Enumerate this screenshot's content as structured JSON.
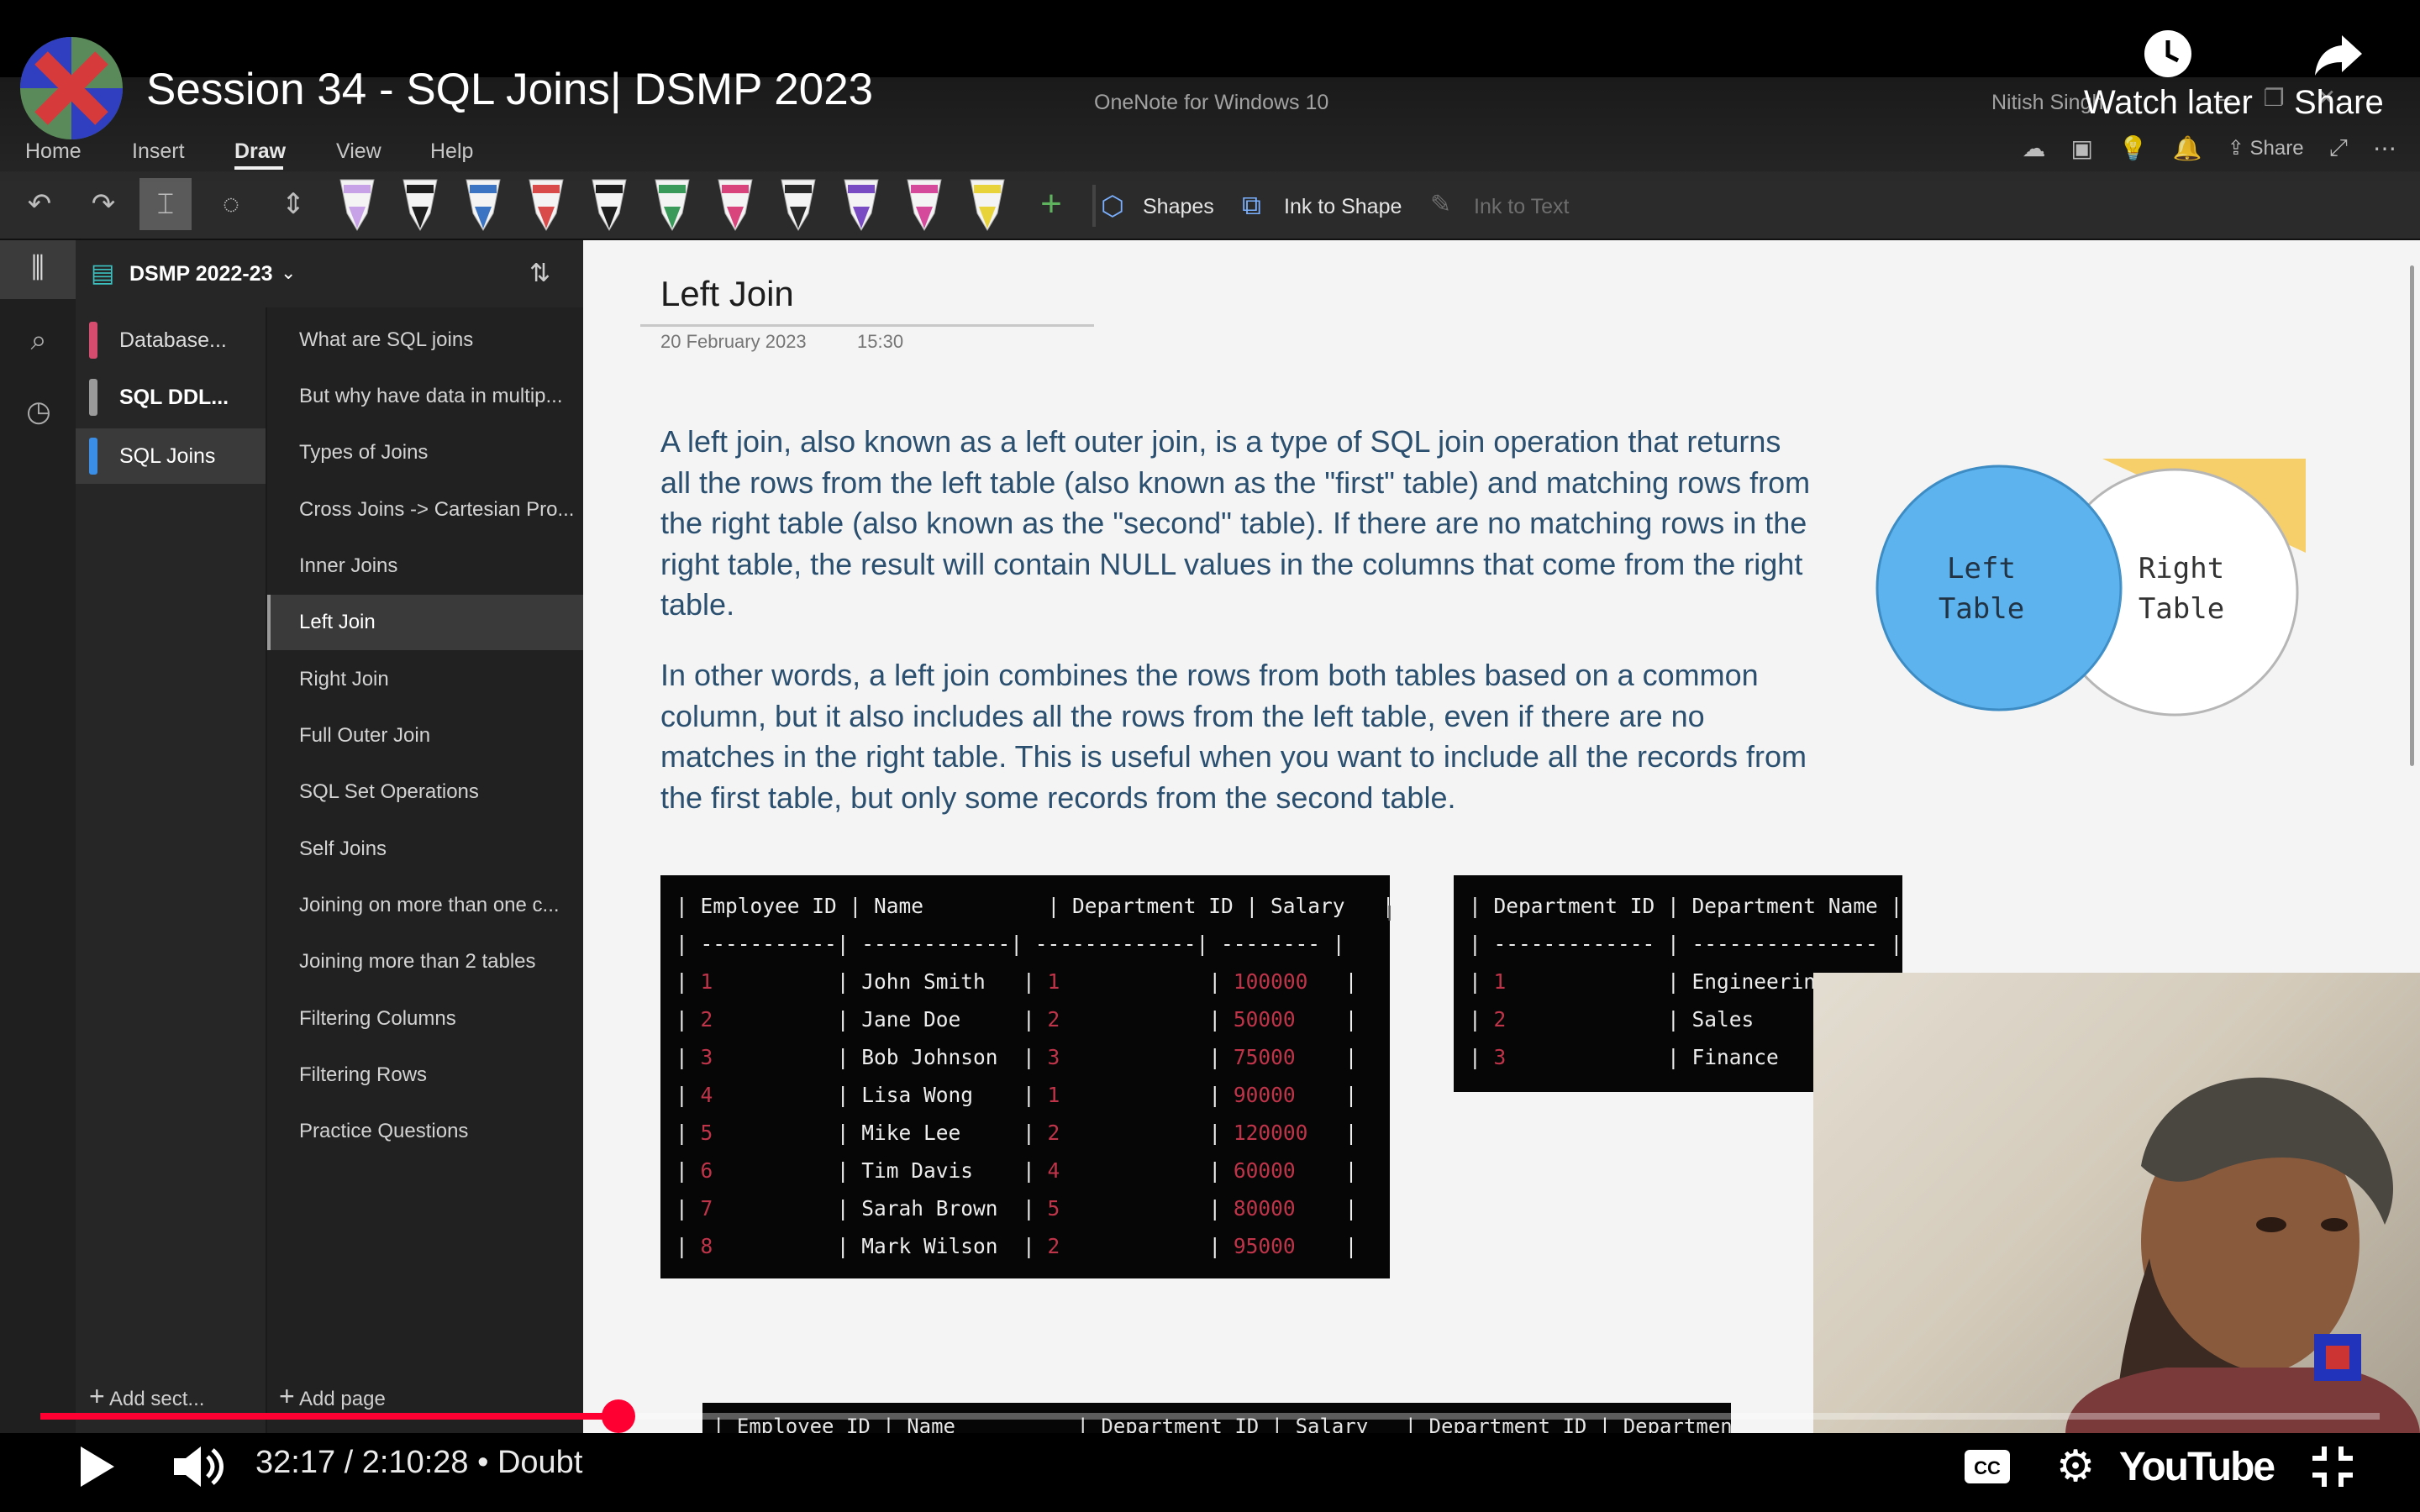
{
  "video": {
    "title": "Session 34 - SQL Joins| DSMP 2023",
    "watch_later": "Watch later",
    "share": "Share",
    "current_time": "32:17",
    "duration": "2:10:28",
    "chapter": "Doubt",
    "time_display": "32:17 / 2:10:28 • Doubt",
    "progress": 0.247,
    "youtube_label": "YouTube",
    "accent_color": "#ff0033"
  },
  "window": {
    "app_title": "OneNote for Windows 10",
    "user": "Nitish Singh",
    "share_label": "Share"
  },
  "menu": [
    "Home",
    "Insert",
    "Draw",
    "View",
    "Help"
  ],
  "toolbar": {
    "shapes_label": "Shapes",
    "ink_to_shape_label": "Ink to Shape",
    "ink_to_text_label": "Ink to Text",
    "pen_colors": [
      "#c8a2e6",
      "#1e1e1e",
      "#3c74c4",
      "#d94a4a",
      "#1e1e1e",
      "#3a9a5a",
      "#d9447c",
      "#2a2a2a",
      "#7a4cc4",
      "#d64a9c",
      "#e8d33a"
    ]
  },
  "notebook": {
    "name": "DSMP 2022-23",
    "sections": [
      {
        "label": "Database...",
        "color": "#d64c6e"
      },
      {
        "label": "SQL DDL...",
        "color": "#9a9a9a"
      },
      {
        "label": "SQL Joins",
        "color": "#3a8ee6"
      }
    ],
    "pages": [
      "What are SQL joins",
      "But why have data in multip...",
      "Types of Joins",
      "Cross Joins -> Cartesian Pro...",
      "Inner Joins",
      "Left Join",
      "Right Join",
      "Full Outer Join",
      "SQL Set Operations",
      "Self Joins",
      "Joining on more than one c...",
      "Joining more than 2 tables",
      "Filtering Columns",
      "Filtering Rows",
      "Practice Questions"
    ],
    "add_section": "Add sect...",
    "add_page": "Add page"
  },
  "page": {
    "title": "Left Join",
    "date": "20 February 2023",
    "time": "15:30",
    "paragraph1": "A left join, also known as a left outer join, is a type of SQL join operation that returns all the rows from the left table (also known as the \"first\" table) and matching rows from the right table (also known as the \"second\" table). If there are no matching rows in the right table, the result will contain NULL values in the columns that come from the right table.",
    "paragraph2": "In other words, a left join combines the rows from both tables based on a common column, but it also includes all the rows from the left table, even if there are no matches in the right table. This is useful when you want to include all the records from the first table, but only some records from the second table.",
    "venn": {
      "left": "Left\nTable",
      "right": "Right\nTable",
      "left_l1": "Left",
      "left_l2": "Table",
      "right_l1": "Right",
      "right_l2": "Table"
    }
  },
  "employees_table": {
    "header": "| Employee ID | Name          | Department ID | Salary   |",
    "separator": "| -----------| ------------| -------------| -------- |",
    "rows": [
      {
        "id": "1",
        "name": "John Smith",
        "dept": "1",
        "salary": "100000"
      },
      {
        "id": "2",
        "name": "Jane Doe",
        "dept": "2",
        "salary": "50000"
      },
      {
        "id": "3",
        "name": "Bob Johnson",
        "dept": "3",
        "salary": "75000"
      },
      {
        "id": "4",
        "name": "Lisa Wong",
        "dept": "1",
        "salary": "90000"
      },
      {
        "id": "5",
        "name": "Mike Lee",
        "dept": "2",
        "salary": "120000"
      },
      {
        "id": "6",
        "name": "Tim Davis",
        "dept": "4",
        "salary": "60000"
      },
      {
        "id": "7",
        "name": "Sarah Brown",
        "dept": "5",
        "salary": "80000"
      },
      {
        "id": "8",
        "name": "Mark Wilson",
        "dept": "2",
        "salary": "95000"
      }
    ]
  },
  "departments_table": {
    "header": "| Department ID | Department Name |",
    "separator": "| ------------- | --------------- |",
    "rows": [
      {
        "id": "1",
        "name": "Engineering"
      },
      {
        "id": "2",
        "name": "Sales"
      },
      {
        "id": "3",
        "name": "Finance"
      }
    ]
  },
  "result_table_partial": "| Employee ID | Name          | Department ID | Salary   | Department ID | Department"
}
